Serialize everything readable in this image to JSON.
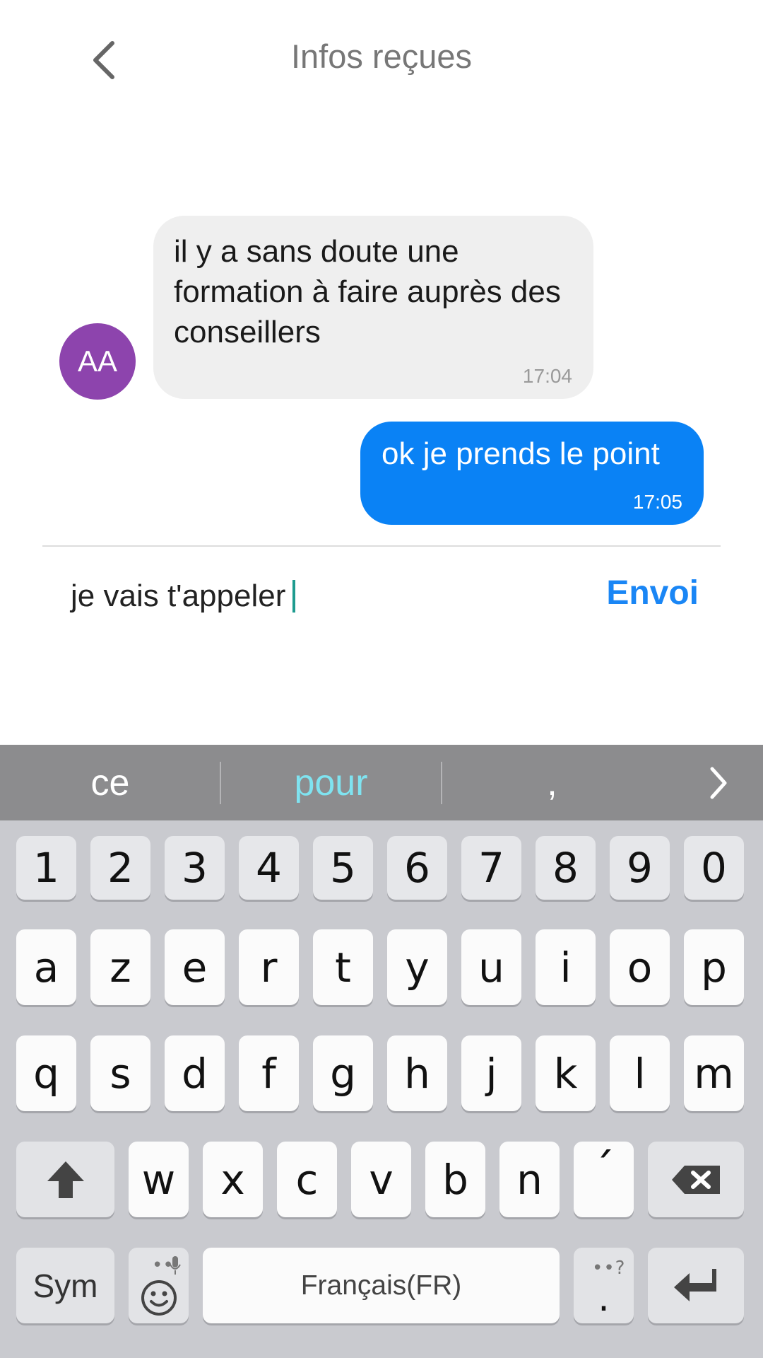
{
  "colors": {
    "accent": "#1a86f5",
    "outgoing_bubble": "#0a82f5",
    "avatar": "#8d44ad",
    "suggestion_highlight": "#7fe3f0"
  },
  "header": {
    "title": "Infos reçues",
    "back_icon": "chevron-left-icon"
  },
  "messages": [
    {
      "direction": "incoming",
      "avatar_initials": "AA",
      "text": "il y a sans doute une formation à faire auprès des conseillers",
      "time": "17:04"
    },
    {
      "direction": "outgoing",
      "text": "ok je prends le point",
      "time": "17:05"
    }
  ],
  "composer": {
    "value": "je vais t'appeler",
    "send_label": "Envoi"
  },
  "keyboard": {
    "suggestions": [
      "ce",
      "pour",
      ","
    ],
    "suggestion_highlighted_index": 1,
    "more_icon": "chevron-right-icon",
    "number_row": [
      "1",
      "2",
      "3",
      "4",
      "5",
      "6",
      "7",
      "8",
      "9",
      "0"
    ],
    "row1": [
      "a",
      "z",
      "e",
      "r",
      "t",
      "y",
      "u",
      "i",
      "o",
      "p"
    ],
    "row2": [
      "q",
      "s",
      "d",
      "f",
      "g",
      "h",
      "j",
      "k",
      "l",
      "m"
    ],
    "row3": [
      "w",
      "x",
      "c",
      "v",
      "b",
      "n",
      "´"
    ],
    "shift_icon": "shift-arrow-icon",
    "backspace_icon": "backspace-icon",
    "sym_label": "Sym",
    "emoji_icon": "emoji-icon",
    "mic_icon": "microphone-icon",
    "emoji_hint": "••",
    "space_label": "Français(FR)",
    "period_hint": "••?",
    "period_label": ".",
    "enter_icon": "enter-icon"
  }
}
